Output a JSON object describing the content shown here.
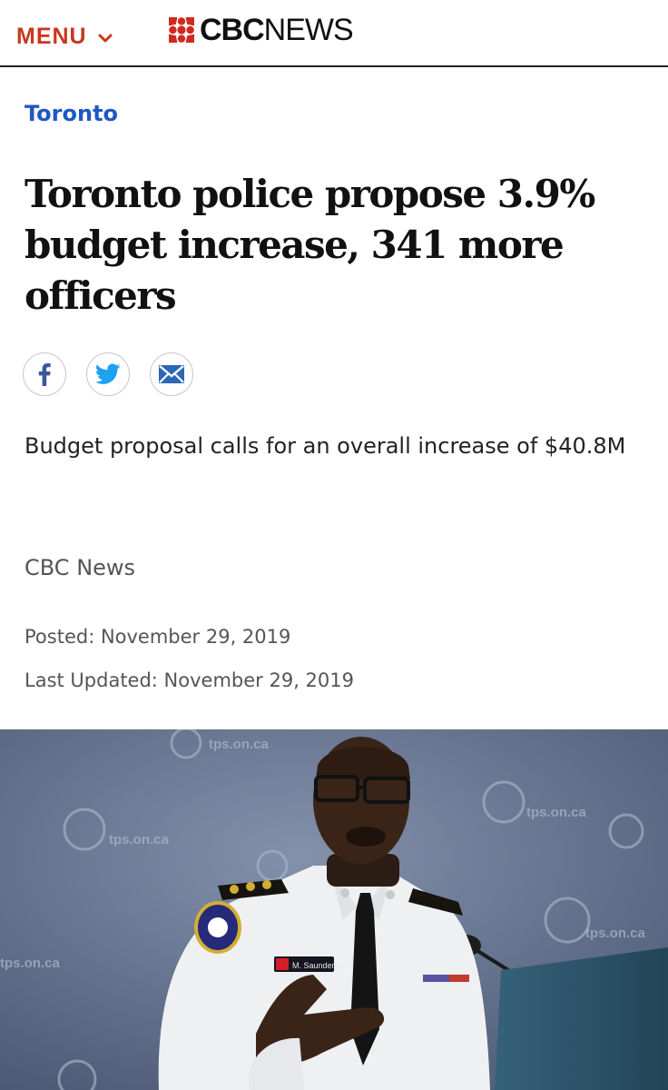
{
  "header": {
    "menu_label": "MENU",
    "logo_cbc": "CBC",
    "logo_news": "NEWS"
  },
  "article": {
    "section": "Toronto",
    "headline": "Toronto police propose 3.9% budget increase, 341 more officers",
    "deck": "Budget proposal calls for an overall increase of $40.8M",
    "byline": "CBC News",
    "posted": "Posted: November 29, 2019",
    "updated": "Last Updated: November 29, 2019"
  },
  "share": [
    {
      "icon": "facebook-icon"
    },
    {
      "icon": "twitter-icon"
    },
    {
      "icon": "email-icon"
    }
  ],
  "photo": {
    "watermark_text": "tps.on.ca",
    "nameplate": "M. Saunders"
  },
  "colors": {
    "menu_red": "#c8381f",
    "link_blue": "#1f58c4",
    "twitter_blue": "#1da1f2",
    "facebook_blue": "#3b5998"
  }
}
